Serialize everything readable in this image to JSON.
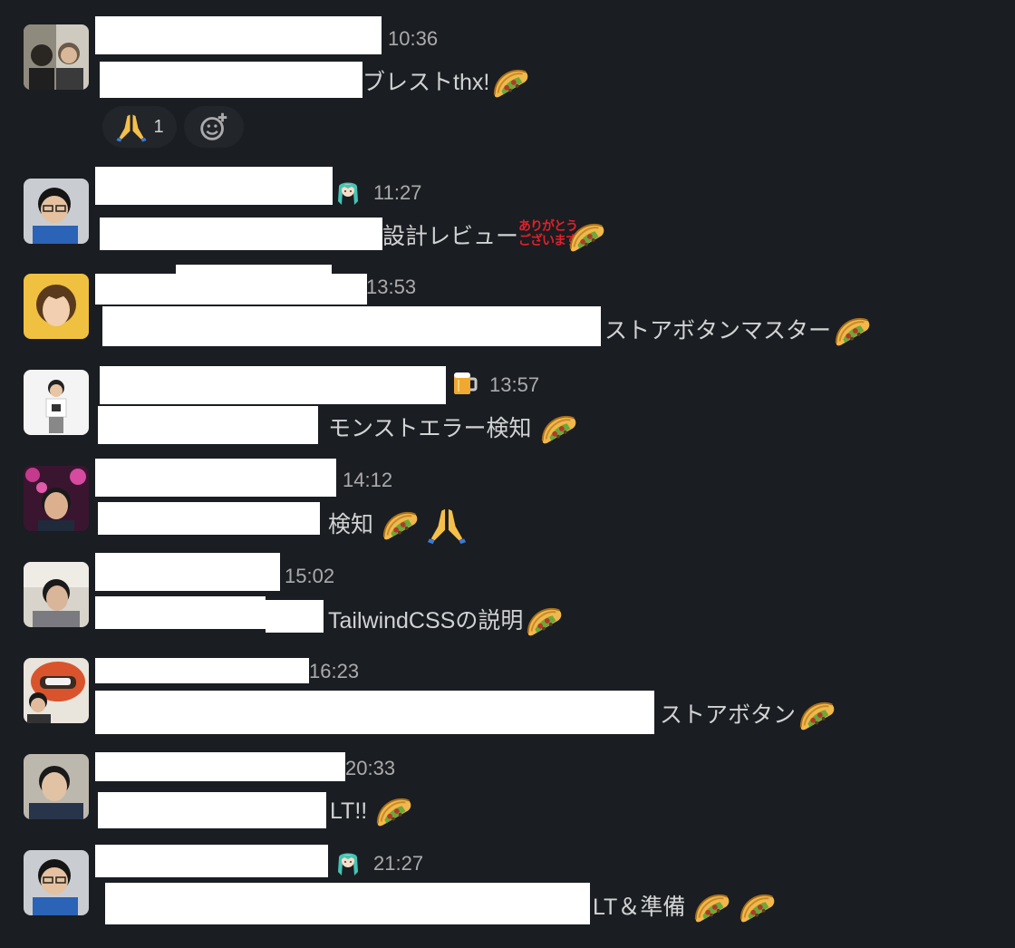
{
  "colors": {
    "background": "#1a1d21",
    "text": "#d1d2d3",
    "timestamp": "#ababad",
    "redaction": "#ffffff",
    "reaction_bg": "#222529"
  },
  "messages": [
    {
      "time": "10:36",
      "text": "ブレストthx!",
      "emojis": [
        "taco-icon"
      ],
      "reactions": [
        {
          "icon": "folded-hands-icon",
          "count": "1"
        }
      ],
      "add_reaction_icon": "add-reaction-icon"
    },
    {
      "time": "11:27",
      "status_icon": "miku-icon",
      "text": "設計レビュー",
      "emojis": [
        "arigatou-gozaimasu-stamp",
        "taco-icon"
      ],
      "stamp_text_1": "ありがとう",
      "stamp_text_2": "ございます"
    },
    {
      "time": "13:53",
      "text": "ストアボタンマスター",
      "emojis": [
        "taco-icon"
      ]
    },
    {
      "time": "13:57",
      "status_icon": "beer-icon",
      "text": "モンストエラー検知",
      "emojis": [
        "taco-icon"
      ]
    },
    {
      "time": "14:12",
      "text": "検知",
      "emojis": [
        "taco-icon",
        "folded-hands-icon"
      ]
    },
    {
      "time": "15:02",
      "text": "TailwindCSSの説明",
      "emojis": [
        "taco-icon"
      ]
    },
    {
      "time": "16:23",
      "text": "ストアボタン",
      "emojis": [
        "taco-icon"
      ]
    },
    {
      "time": "20:33",
      "text": "LT!!",
      "emojis": [
        "taco-icon"
      ]
    },
    {
      "time": "21:27",
      "status_icon": "miku-icon",
      "text": "LT＆準備",
      "emojis": [
        "taco-icon",
        "taco-icon"
      ]
    }
  ]
}
